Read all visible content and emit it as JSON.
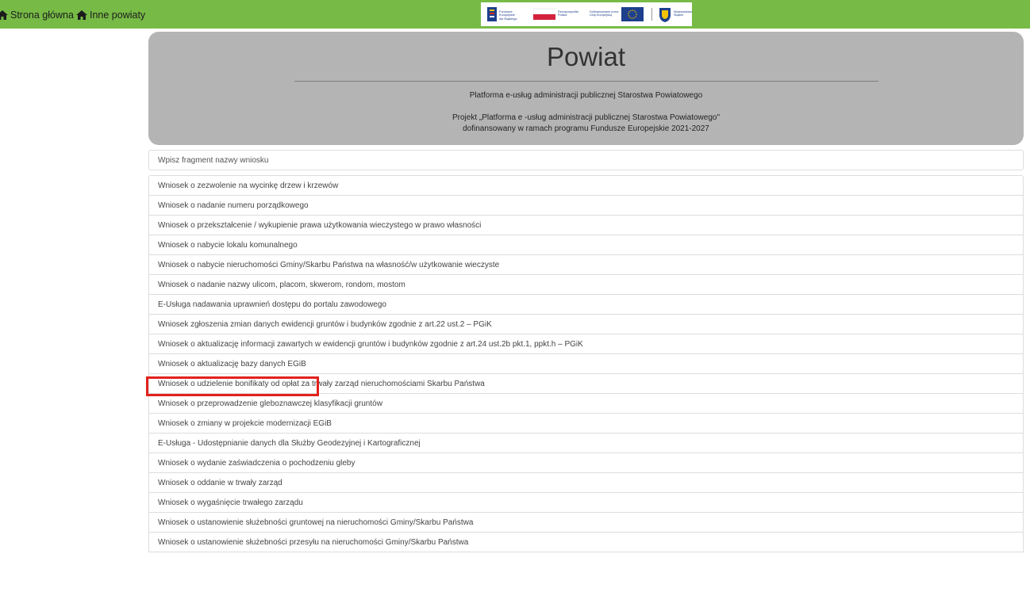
{
  "nav": {
    "home_label": "Strona główna",
    "other_label": "Inne powiaty"
  },
  "logos": {
    "fe_label": "Fundusze Europejskie\ndla Śląskiego",
    "rp_label": "Rzeczpospolita\nPolska",
    "eu_label": "Dofinansowane przez\nUnię Europejską",
    "region_label": "Województwo\nŚląskie"
  },
  "hero": {
    "title": "Powiat",
    "subtitle": "Platforma e-usług administracji publicznej Starostwa Powiatowego",
    "project_line1": "Projekt „Platforma e -usług administracji publicznej Starostwa Powiatowego\"",
    "project_line2": "dofinansowany w ramach programu Fundusze Europejskie 2021-2027"
  },
  "search": {
    "placeholder": "Wpisz fragment nazwy wniosku"
  },
  "requests": [
    "Wniosek o zezwolenie na wycinkę drzew i krzewów",
    "Wniosek o nadanie numeru porządkowego",
    "Wniosek o przekształcenie / wykupienie prawa użytkowania wieczystego w prawo własności",
    "Wniosek o nabycie lokalu komunalnego",
    "Wniosek o nabycie nieruchomości Gminy/Skarbu Państwa na własność/w użytkowanie wieczyste",
    "Wniosek o nadanie nazwy ulicom, placom, skwerom, rondom, mostom",
    "E-Usługa nadawania uprawnień dostępu do portalu zawodowego",
    "Wniosek zgłoszenia zmian danych ewidencji gruntów i budynków zgodnie z art.22 ust.2 – PGiK",
    "Wniosek o aktualizację informacji zawartych w ewidencji gruntów i budynków zgodnie z art.24 ust.2b pkt.1, ppkt.h – PGiK",
    "Wniosek o aktualizację bazy danych EGiB",
    "Wniosek o udzielenie bonifikaty od opłat za trwały zarząd nieruchomościami Skarbu Państwa",
    "Wniosek o przeprowadzenie gleboznawczej klasyfikacji gruntów",
    "Wniosek o zmiany w projekcie modernizacji EGiB",
    "E-Usługa - Udostępnianie danych dla Służby Geodezyjnej i Kartograficznej",
    "Wniosek o wydanie zaświadczenia o pochodzeniu gleby",
    "Wniosek o oddanie w trwały zarząd",
    "Wniosek o wygaśnięcie trwałego zarządu",
    "Wniosek o ustanowienie służebności gruntowej na nieruchomości Gminy/Skarbu Państwa",
    "Wniosek o ustanowienie służebności przesyłu na nieruchomości Gminy/Skarbu Państwa"
  ],
  "highlighted_index": 9,
  "colors": {
    "topbar": "#77bb46",
    "hero_bg": "#b4b4b4",
    "highlight_border": "#e2211d",
    "list_border": "#dddddd"
  },
  "icons": {
    "home": "home-icon",
    "other": "home-icon"
  }
}
